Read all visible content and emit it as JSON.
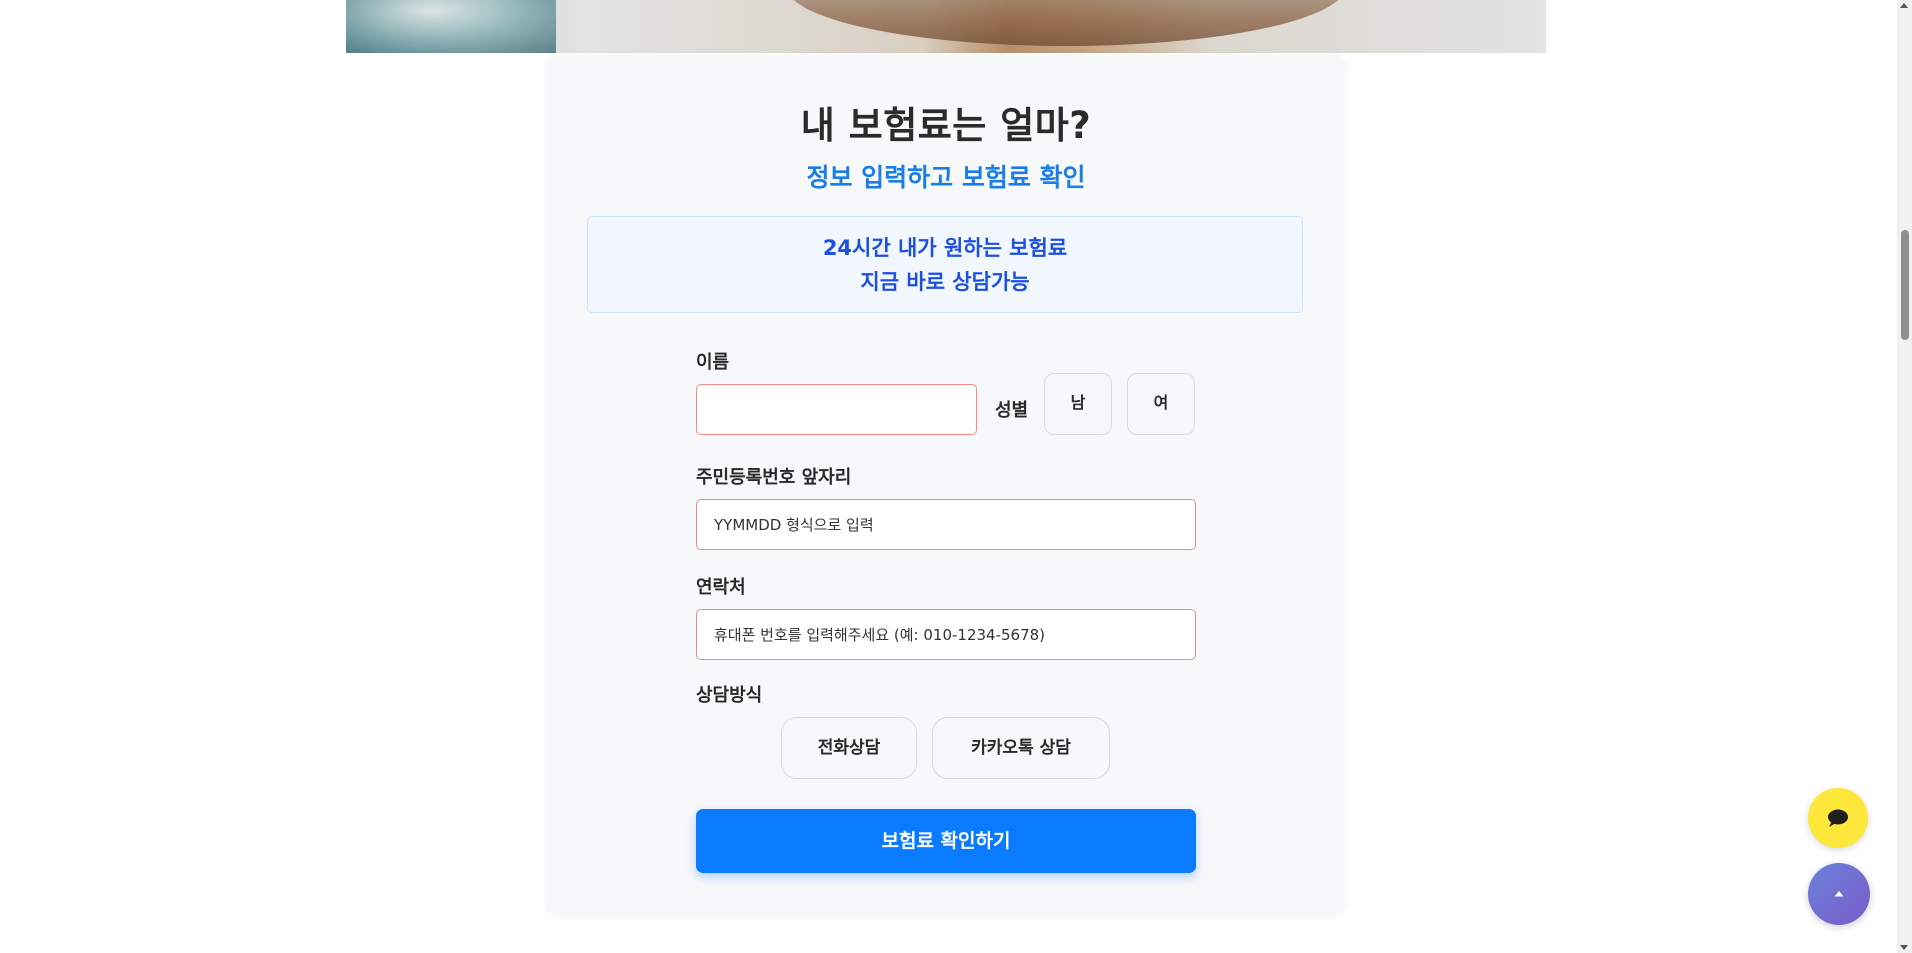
{
  "form": {
    "title": "내 보험료는 얼마?",
    "subtitle": "정보 입력하고 보험료 확인",
    "notice": {
      "line1": "24시간 내가 원하는 보험료",
      "line2": "지금 바로 상담가능"
    },
    "name": {
      "label": "이름",
      "value": "",
      "placeholder": ""
    },
    "gender": {
      "label": "성별",
      "options": [
        "남",
        "여"
      ]
    },
    "birth": {
      "label": "주민등록번호 앞자리",
      "placeholder": "YYMMDD 형식으로 입력"
    },
    "phone": {
      "label": "연락처",
      "placeholder": "휴대폰 번호를 입력해주세요 (예: 010-1234-5678)"
    },
    "method": {
      "label": "상담방식",
      "options": [
        "전화상담",
        "카카오톡 상담"
      ]
    },
    "submit_label": "보험료 확인하기"
  },
  "colors": {
    "accent": "#0a7bff",
    "subtitle": "#1a7ee6",
    "notice_text": "#1d4fe0",
    "input_border": "#f08a8a",
    "kakao": "#fde73a"
  },
  "icons": {
    "floating_chat": "speech-bubble-icon",
    "scroll_top": "caret-up-icon"
  }
}
